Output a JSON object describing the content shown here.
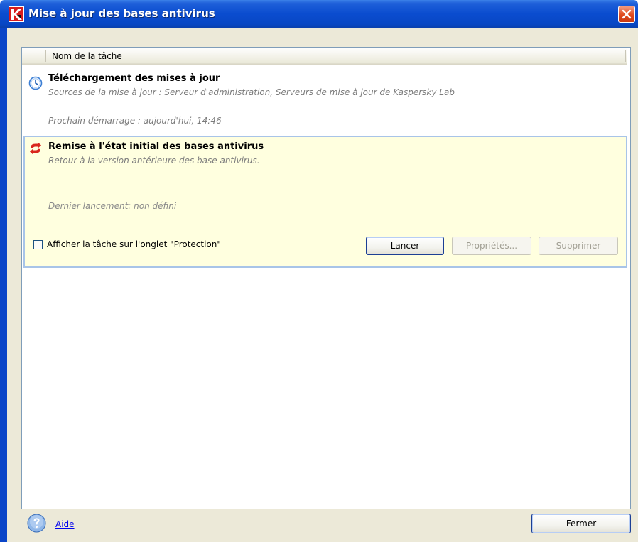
{
  "window": {
    "title": "Mise à jour des bases antivirus"
  },
  "list": {
    "column_header": "Nom de la tâche"
  },
  "tasks": [
    {
      "title": "Téléchargement des mises à jour",
      "description": "Sources de la mise à jour : Serveur d'administration, Serveurs de mise à jour de Kaspersky Lab",
      "schedule": "Prochain démarrage : aujourd'hui, 14:46",
      "icon": "clock-icon"
    },
    {
      "title": "Remise à l'état initial des bases antivirus",
      "description": "Retour à la version antérieure des base antivirus.",
      "last_run": "Dernier lancement: non défini",
      "icon": "rollback-arrows-icon",
      "checkbox_label": "Afficher la tâche sur l'onglet \"Protection\"",
      "checkbox_checked": false,
      "buttons": {
        "run": "Lancer",
        "properties": "Propriétés...",
        "delete": "Supprimer"
      }
    }
  ],
  "footer": {
    "help_label": "Aide",
    "close_label": "Fermer"
  },
  "colors": {
    "titlebar": "#0a4ccf",
    "selected_row_bg": "#ffffdf",
    "selected_row_border": "#a8c4e8",
    "close_button": "#e04b20"
  }
}
